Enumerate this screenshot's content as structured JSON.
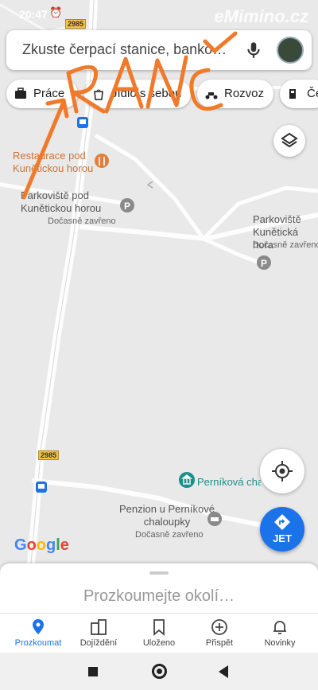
{
  "status_bar": {
    "time": "20:47",
    "alarm_icon": "alarm-icon",
    "watermark": "eMimino.cz"
  },
  "search": {
    "placeholder": "Zkuste čerpací stanice, banko…",
    "mic_icon": "mic-icon",
    "avatar": "user-avatar"
  },
  "chips": [
    {
      "label": "Práce",
      "icon": "briefcase-icon"
    },
    {
      "label": "Jídlo s sebou",
      "icon": "takeout-bag-icon"
    },
    {
      "label": "Rozvoz",
      "icon": "scooter-icon"
    },
    {
      "label": "Če",
      "icon": "gas-station-icon"
    }
  ],
  "map": {
    "road_number_1": "2985",
    "road_number_2": "2985",
    "restaurant": "Restaurace pod Kunětickou horou",
    "parking_1_name": "Parkoviště pod Kunětickou horou",
    "parking_1_status": "Dočasně zavřeno",
    "parking_2_name": "Parkoviště Kunětická hora",
    "parking_2_status": "Dočasně zavřeno",
    "museum": "Perníková chaloupka",
    "pension_name": "Penzion u Perníkové chaloupky",
    "pension_status": "Dočasně zavřeno",
    "google_logo": "Google"
  },
  "colors": {
    "accent": "#1a73e8",
    "scribble": "#f07a2a",
    "teal": "#1b8f8a",
    "orange_poi": "#c8763a"
  },
  "handwriting": "RANČ",
  "buttons": {
    "jet_label": "JET"
  },
  "sheet": {
    "title": "Prozkoumejte okolí…"
  },
  "bottom_nav": [
    {
      "label": "Prozkoumat",
      "icon": "explore-pin-icon",
      "active": true
    },
    {
      "label": "Dojíždění",
      "icon": "commute-icon",
      "active": false
    },
    {
      "label": "Uloženo",
      "icon": "bookmark-icon",
      "active": false
    },
    {
      "label": "Přispět",
      "icon": "add-circle-icon",
      "active": false
    },
    {
      "label": "Novinky",
      "icon": "bell-icon",
      "active": false
    }
  ]
}
